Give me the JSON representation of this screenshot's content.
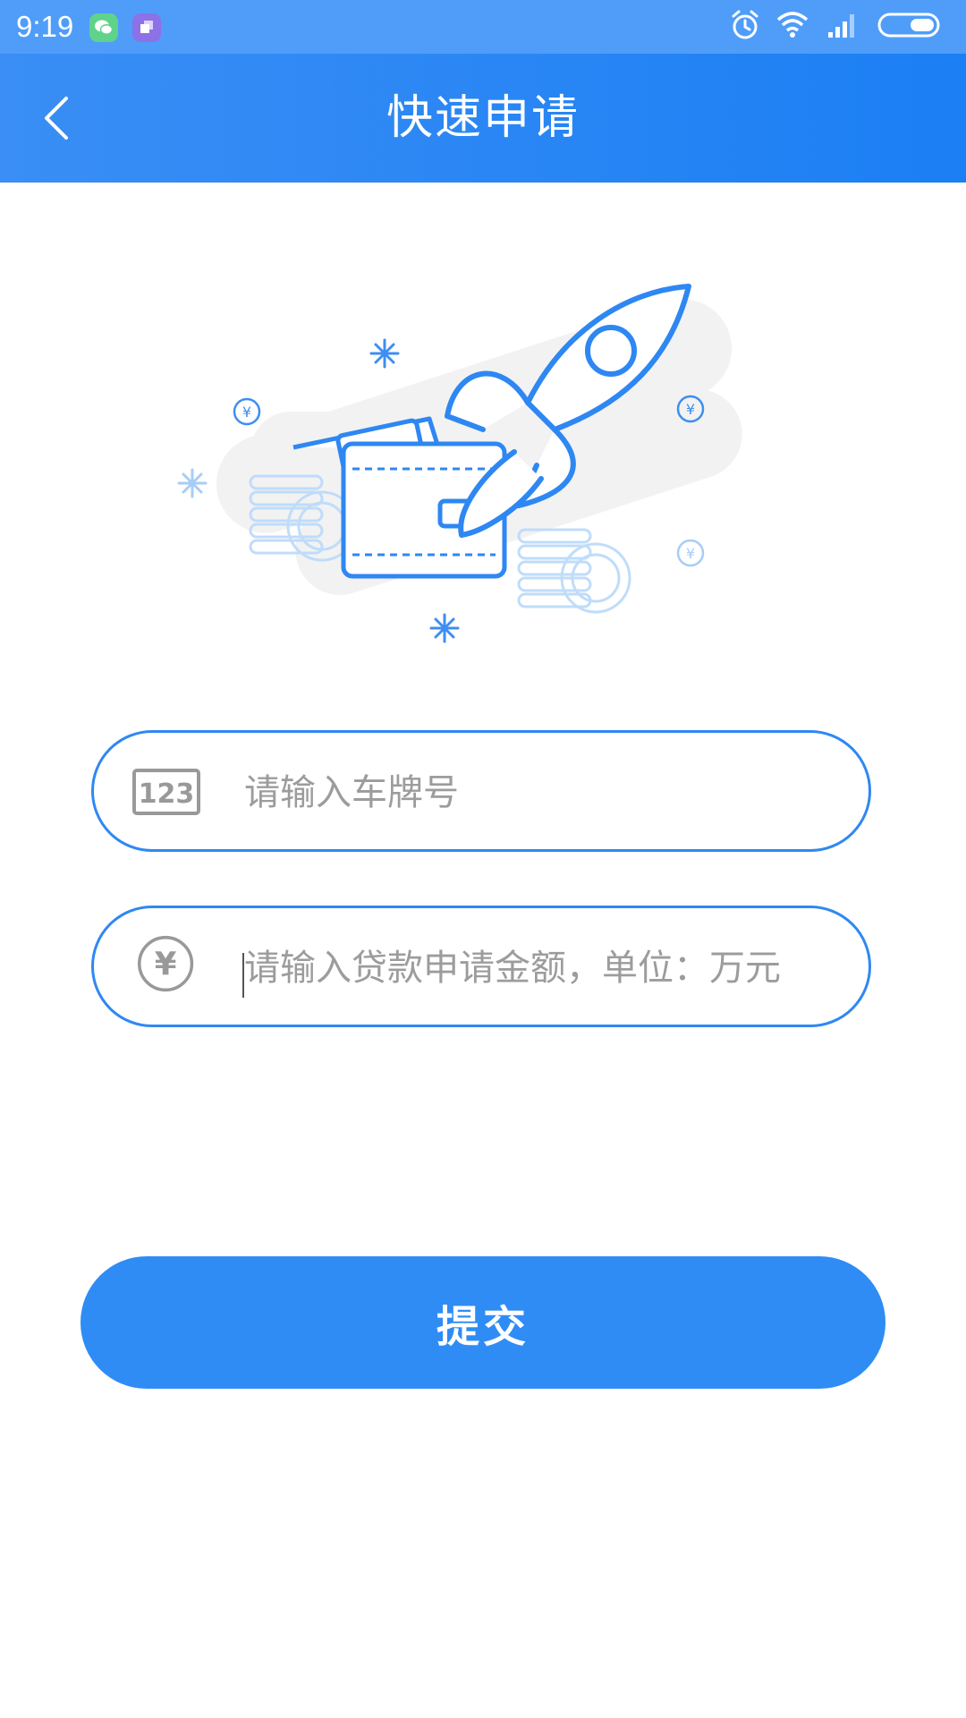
{
  "status_bar": {
    "time": "9:19",
    "icons": [
      "wechat-icon",
      "app-icon",
      "alarm-icon",
      "wifi-icon",
      "signal-icon",
      "battery-icon"
    ]
  },
  "header": {
    "title": "快速申请",
    "back_icon": "chevron-left-icon"
  },
  "illustration": {
    "description_icon": "rocket-wallet-illustration"
  },
  "form": {
    "plate": {
      "icon": "123-icon",
      "placeholder": "请输入车牌号",
      "value": ""
    },
    "amount": {
      "icon": "yuan-icon",
      "placeholder": "请输入贷款申请金额，单位：万元",
      "value": ""
    }
  },
  "submit": {
    "label": "提交"
  },
  "colors": {
    "primary": "#2f8cf5",
    "status_bar": "#4f9df9",
    "border": "#2f88f2",
    "placeholder": "#9c9c9c"
  }
}
